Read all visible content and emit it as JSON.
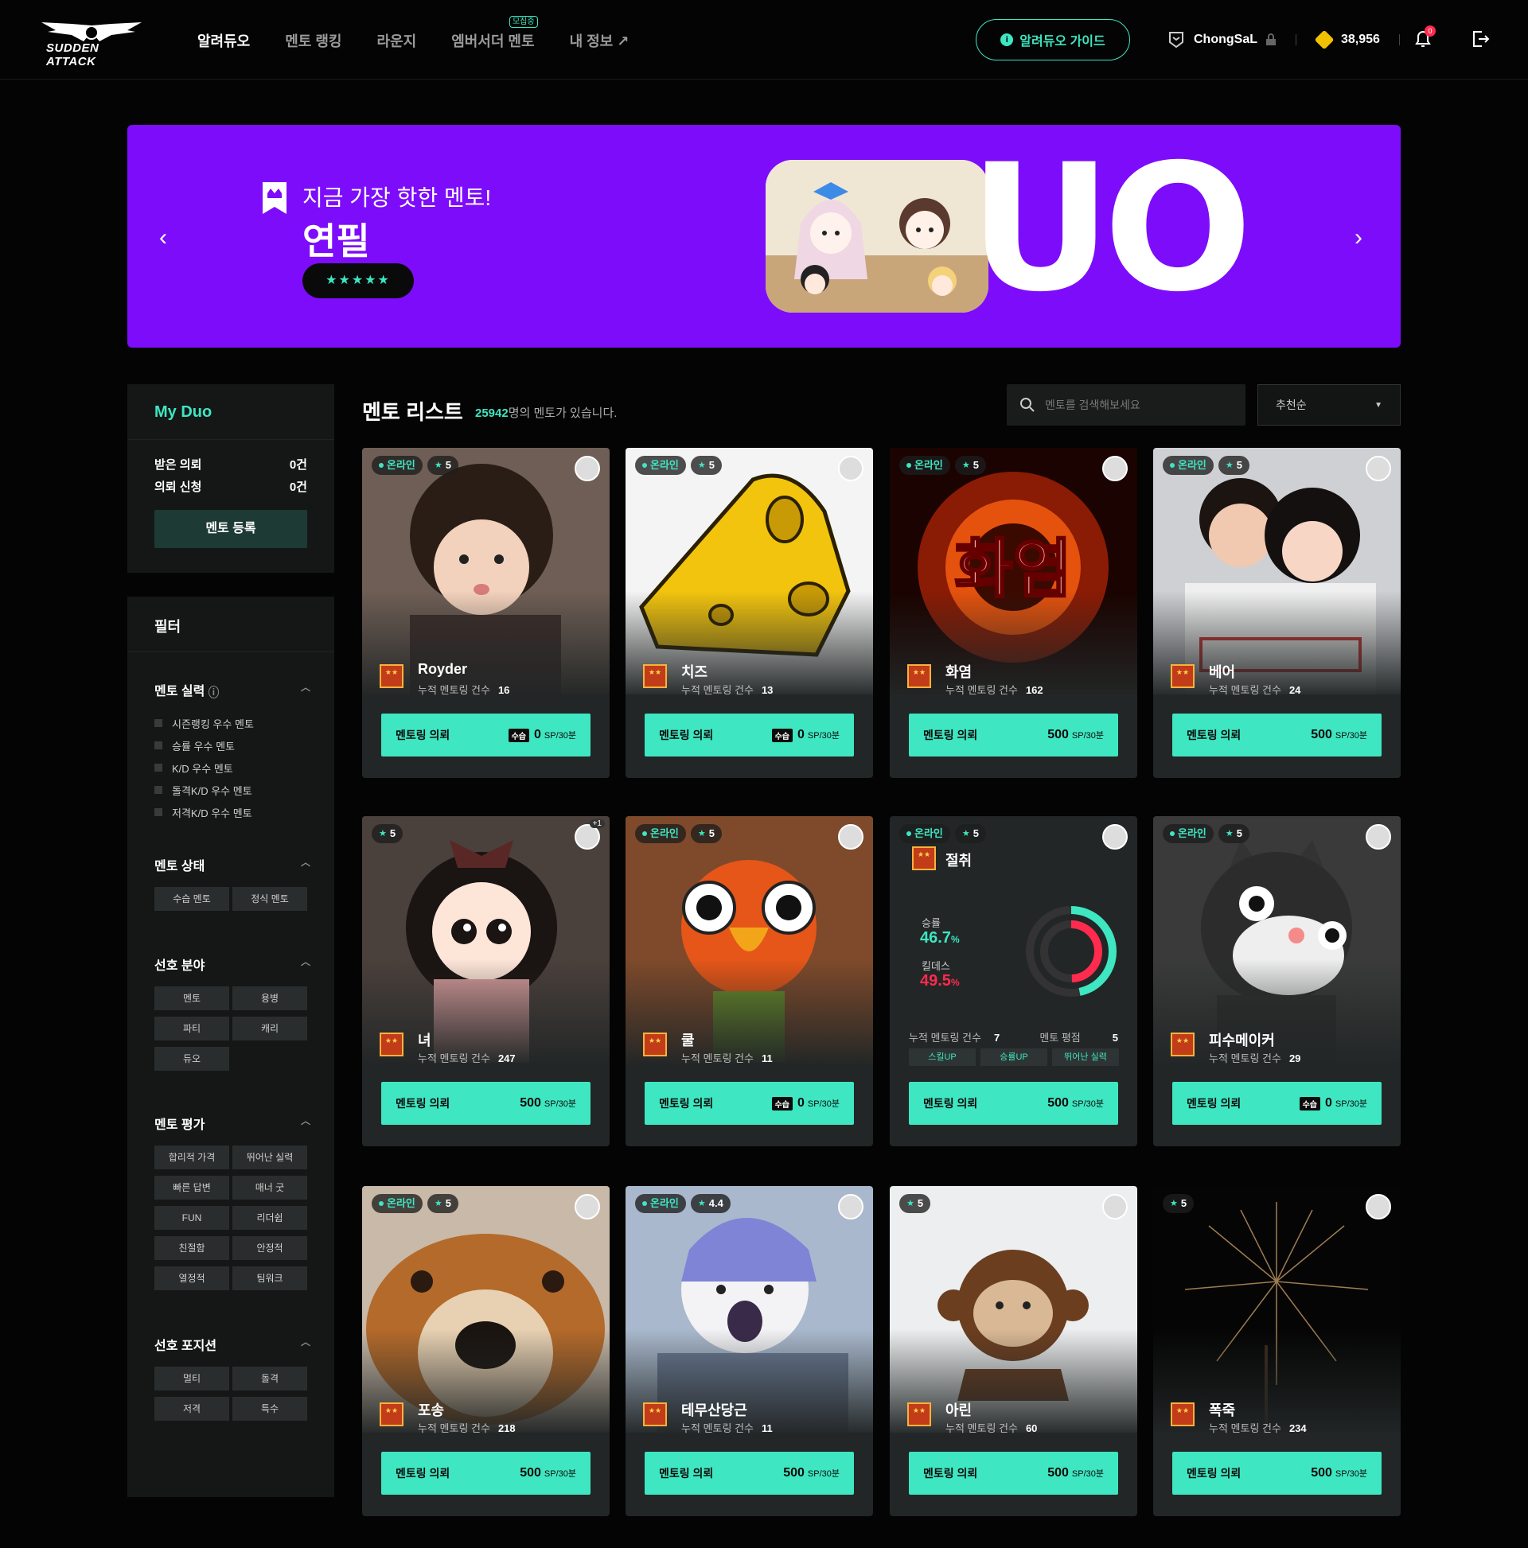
{
  "header": {
    "logo_text": "SUDDEN ATTACK",
    "nav": [
      {
        "label": "알려듀오",
        "active": true
      },
      {
        "label": "멘토 랭킹",
        "active": false
      },
      {
        "label": "라운지",
        "active": false
      },
      {
        "label": "엠버서더 멘토",
        "active": false,
        "badge": "모집중"
      },
      {
        "label": "내 정보 ↗",
        "active": false
      }
    ],
    "guide_button": "알려듀오 가이드",
    "username": "ChongSaL",
    "points": "38,956",
    "notification_count": "0"
  },
  "banner": {
    "tagline": "지금 가장 핫한 멘토!",
    "mentor_name": "연필",
    "stars": "★★★★★",
    "big_text": "UO",
    "prev_label": "‹",
    "next_label": "›"
  },
  "my_duo": {
    "title": "My Duo",
    "received_label": "받은 의뢰",
    "received_value": "0건",
    "sent_label": "의뢰 신청",
    "sent_value": "0건",
    "register_button": "멘토 등록"
  },
  "filters": {
    "title": "필터",
    "skill_title": "멘토 실력",
    "skill_options": [
      "시즌랭킹 우수 멘토",
      "승률 우수 멘토",
      "K/D 우수 멘토",
      "돌격K/D 우수 멘토",
      "저격K/D 우수 멘토"
    ],
    "status_title": "멘토 상태",
    "status_options": [
      "수습 멘토",
      "정식 멘토"
    ],
    "field_title": "선호 분야",
    "field_options": [
      "멘토",
      "용병",
      "파티",
      "캐리",
      "듀오"
    ],
    "rating_title": "멘토 평가",
    "rating_options": [
      "합리적 가격",
      "뛰어난 실력",
      "빠른 답변",
      "매너 굿",
      "FUN",
      "리더쉽",
      "친절함",
      "안정적",
      "열정적",
      "팀워크"
    ],
    "position_title": "선호 포지션",
    "position_options": [
      "멀티",
      "돌격",
      "저격",
      "특수"
    ]
  },
  "list": {
    "title": "멘토 리스트",
    "count": "25942",
    "count_suffix": "명의 멘토가 있습니다.",
    "search_placeholder": "멘토를 검색해보세요",
    "sort_value": "추천순",
    "online_label": "온라인",
    "count_label": "누적 멘토링 건수",
    "request_label": "멘토링 의뢰",
    "free_label": "수습",
    "unit": "SP/30분"
  },
  "mentors": [
    {
      "name": "Royder",
      "online": true,
      "rating": "5",
      "count": "16",
      "price": "0",
      "trainee": true
    },
    {
      "name": "치즈",
      "online": true,
      "rating": "5",
      "count": "13",
      "price": "0",
      "trainee": true
    },
    {
      "name": "화염",
      "online": true,
      "rating": "5",
      "count": "162",
      "price": "500",
      "trainee": false,
      "image_text": "화염"
    },
    {
      "name": "베어",
      "online": true,
      "rating": "5",
      "count": "24",
      "price": "500",
      "trainee": false
    },
    {
      "name": "녀",
      "online": false,
      "rating": "5",
      "count": "247",
      "price": "500",
      "trainee": false,
      "corner_badge": "+1"
    },
    {
      "name": "쿨",
      "online": true,
      "rating": "5",
      "count": "11",
      "price": "0",
      "trainee": true
    },
    {
      "name": "절취",
      "online": true,
      "rating": "5",
      "count": "7",
      "price": "500",
      "trainee": false,
      "stats": true,
      "win_label": "승률",
      "win_value": "46.7",
      "kd_label": "킬데스",
      "kd_value": "49.5",
      "score_label": "멘토 평점",
      "score_value": "5",
      "chips": [
        "스킬UP",
        "승률UP",
        "뛰어난 실력"
      ]
    },
    {
      "name": "피수메이커",
      "online": true,
      "rating": "5",
      "count": "29",
      "price": "0",
      "trainee": true
    },
    {
      "name": "포송",
      "online": true,
      "rating": "5",
      "count": "218",
      "price": "500",
      "trainee": false
    },
    {
      "name": "테무산당근",
      "online": true,
      "rating": "4.4",
      "count": "11",
      "price": "500",
      "trainee": false
    },
    {
      "name": "아린",
      "online": false,
      "rating": "5",
      "count": "60",
      "price": "500",
      "trainee": false
    },
    {
      "name": "폭죽",
      "online": false,
      "rating": "5",
      "count": "234",
      "price": "500",
      "trainee": false
    }
  ],
  "colors": {
    "accent": "#3ee6c1",
    "banner": "#7d0cfb",
    "kd": "#ff2b4e"
  }
}
